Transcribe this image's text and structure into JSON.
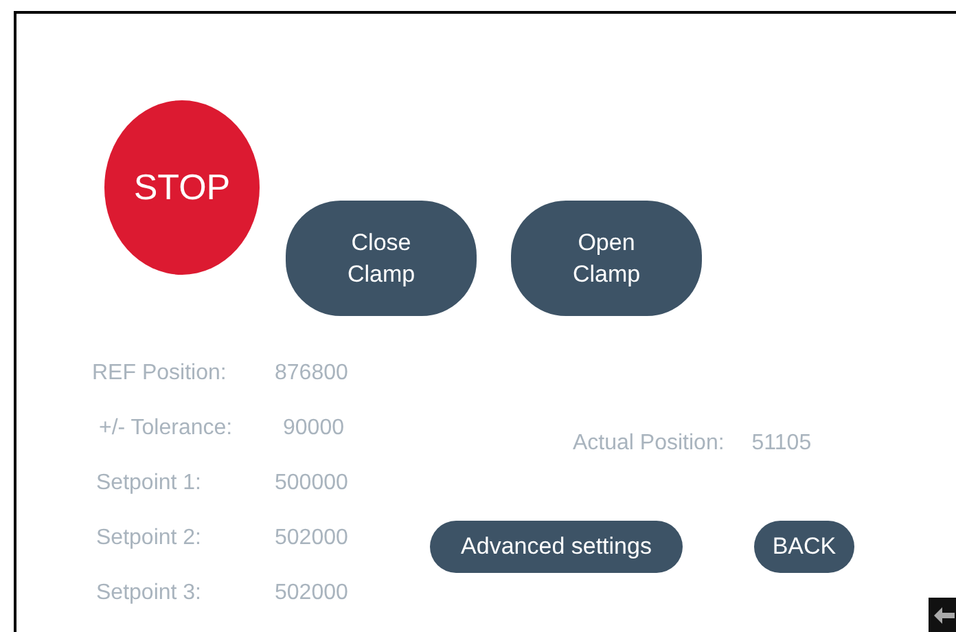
{
  "stop_button": {
    "label": "STOP"
  },
  "clamp_buttons": [
    {
      "label": "Close\nClamp"
    },
    {
      "label": "Open\nClamp"
    }
  ],
  "parameters": [
    {
      "label": "REF Position:",
      "value": "876800"
    },
    {
      "label": "+/- Tolerance:",
      "value": "90000"
    },
    {
      "label": "Setpoint 1:",
      "value": "500000"
    },
    {
      "label": "Setpoint 2:",
      "value": "502000"
    },
    {
      "label": "Setpoint 3:",
      "value": "502000"
    }
  ],
  "actual_position": {
    "label": "Actual Position:",
    "value": "51105"
  },
  "nav_buttons": [
    {
      "label": "Advanced settings"
    },
    {
      "label": "BACK"
    }
  ]
}
